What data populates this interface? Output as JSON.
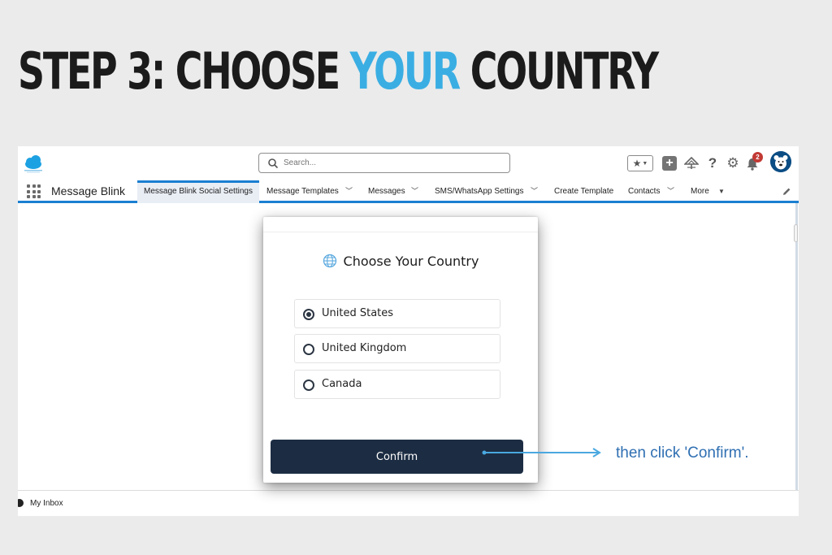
{
  "headline": {
    "prefix": "STEP 3: CHOOSE",
    "highlight": "YOUR",
    "suffix": "COUNTRY"
  },
  "colors": {
    "highlight": "#3aaee3",
    "nav_accent": "#1b7fd1",
    "confirm_bg": "#1c2d43",
    "badge": "#c23934",
    "callout": "#2f6fb2"
  },
  "header": {
    "search_placeholder": "Search...",
    "notification_count": "2",
    "icons": [
      "cloud-logo-icon",
      "search-icon",
      "star-icon",
      "chevron-down-icon",
      "plus-icon",
      "trailhead-icon",
      "help-icon",
      "gear-icon",
      "bell-icon",
      "avatar"
    ]
  },
  "nav": {
    "app_name": "Message Blink",
    "tabs": [
      {
        "label": "Message Blink Social Settings",
        "active": true,
        "dropdown": false
      },
      {
        "label": "Message Templates",
        "dropdown": true
      },
      {
        "label": "Messages",
        "dropdown": true
      },
      {
        "label": "SMS/WhatsApp Settings",
        "dropdown": true
      },
      {
        "label": "Create Template",
        "dropdown": false
      },
      {
        "label": "Contacts",
        "dropdown": true
      },
      {
        "label": "More",
        "dropdown": true
      }
    ]
  },
  "modal": {
    "title": "Choose Your Country",
    "options": [
      {
        "label": "United States",
        "selected": true
      },
      {
        "label": "United Kingdom",
        "selected": false
      },
      {
        "label": "Canada",
        "selected": false
      }
    ],
    "confirm_label": "Confirm"
  },
  "callout": {
    "text": "then click 'Confirm'."
  },
  "footer": {
    "inbox_label": "My Inbox"
  }
}
